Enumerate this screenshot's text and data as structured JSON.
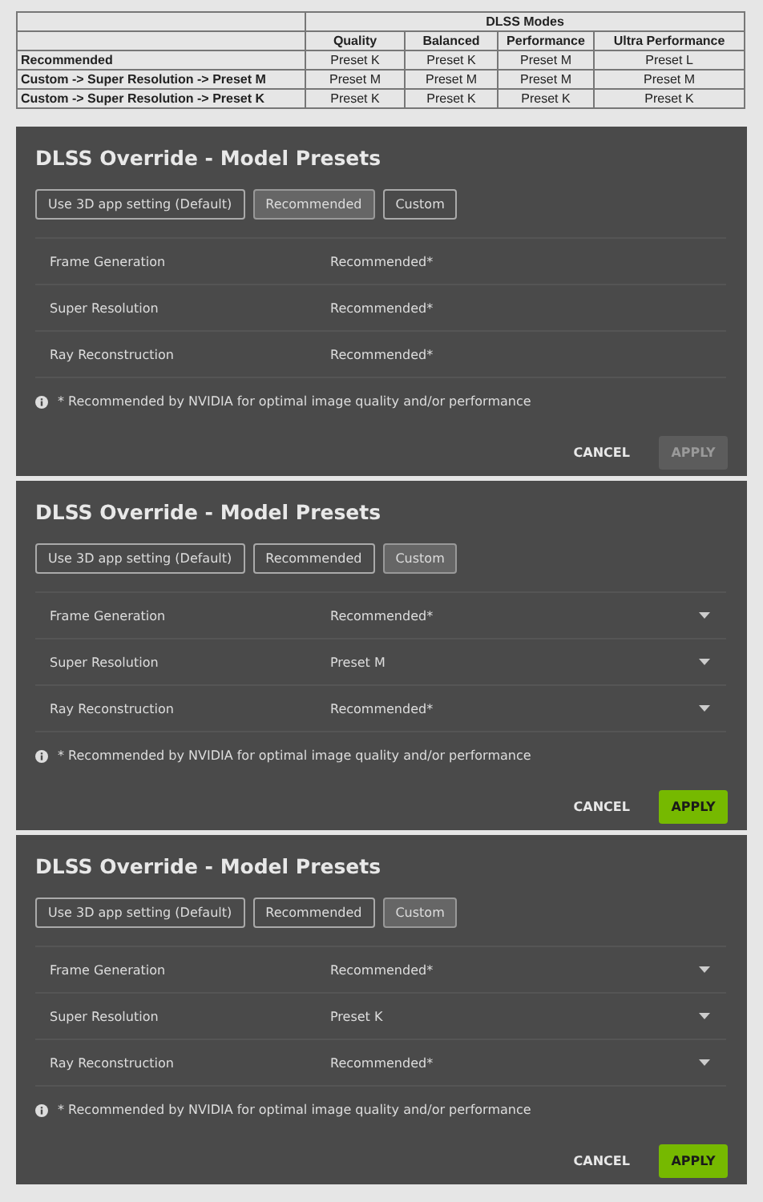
{
  "table": {
    "group_header": "DLSS Modes",
    "columns": [
      "Quality",
      "Balanced",
      "Performance",
      "Ultra Performance"
    ],
    "rows": [
      {
        "label": "Recommended",
        "cells": [
          "Preset K",
          "Preset K",
          "Preset M",
          "Preset L"
        ]
      },
      {
        "label": "Custom -> Super Resolution -> Preset M",
        "cells": [
          "Preset M",
          "Preset M",
          "Preset M",
          "Preset M"
        ]
      },
      {
        "label": "Custom -> Super Resolution -> Preset K",
        "cells": [
          "Preset K",
          "Preset K",
          "Preset K",
          "Preset K"
        ]
      }
    ]
  },
  "panels": [
    {
      "title": "DLSS Override - Model Presets",
      "options": [
        {
          "label": "Use 3D app setting (Default)",
          "selected": false
        },
        {
          "label": "Recommended",
          "selected": true
        },
        {
          "label": "Custom",
          "selected": false
        }
      ],
      "settings": [
        {
          "label": "Frame Generation",
          "value": "Recommended*",
          "dropdown": false
        },
        {
          "label": "Super Resolution",
          "value": "Recommended*",
          "dropdown": false
        },
        {
          "label": "Ray Reconstruction",
          "value": "Recommended*",
          "dropdown": false
        }
      ],
      "note": "* Recommended by NVIDIA for optimal image quality and/or performance",
      "cancel": "CANCEL",
      "apply": {
        "label": "APPLY",
        "disabled": true
      }
    },
    {
      "title": "DLSS Override - Model Presets",
      "options": [
        {
          "label": "Use 3D app setting (Default)",
          "selected": false
        },
        {
          "label": "Recommended",
          "selected": false
        },
        {
          "label": "Custom",
          "selected": true
        }
      ],
      "settings": [
        {
          "label": "Frame Generation",
          "value": "Recommended*",
          "dropdown": true
        },
        {
          "label": "Super Resolution",
          "value": "Preset M",
          "dropdown": true
        },
        {
          "label": "Ray Reconstruction",
          "value": "Recommended*",
          "dropdown": true
        }
      ],
      "note": "* Recommended by NVIDIA for optimal image quality and/or performance",
      "cancel": "CANCEL",
      "apply": {
        "label": "APPLY",
        "disabled": false
      }
    },
    {
      "title": "DLSS Override - Model Presets",
      "options": [
        {
          "label": "Use 3D app setting (Default)",
          "selected": false
        },
        {
          "label": "Recommended",
          "selected": false
        },
        {
          "label": "Custom",
          "selected": true
        }
      ],
      "settings": [
        {
          "label": "Frame Generation",
          "value": "Recommended*",
          "dropdown": true
        },
        {
          "label": "Super Resolution",
          "value": "Preset K",
          "dropdown": true
        },
        {
          "label": "Ray Reconstruction",
          "value": "Recommended*",
          "dropdown": true
        }
      ],
      "note": "* Recommended by NVIDIA for optimal image quality and/or performance",
      "cancel": "CANCEL",
      "apply": {
        "label": "APPLY",
        "disabled": false
      }
    }
  ]
}
